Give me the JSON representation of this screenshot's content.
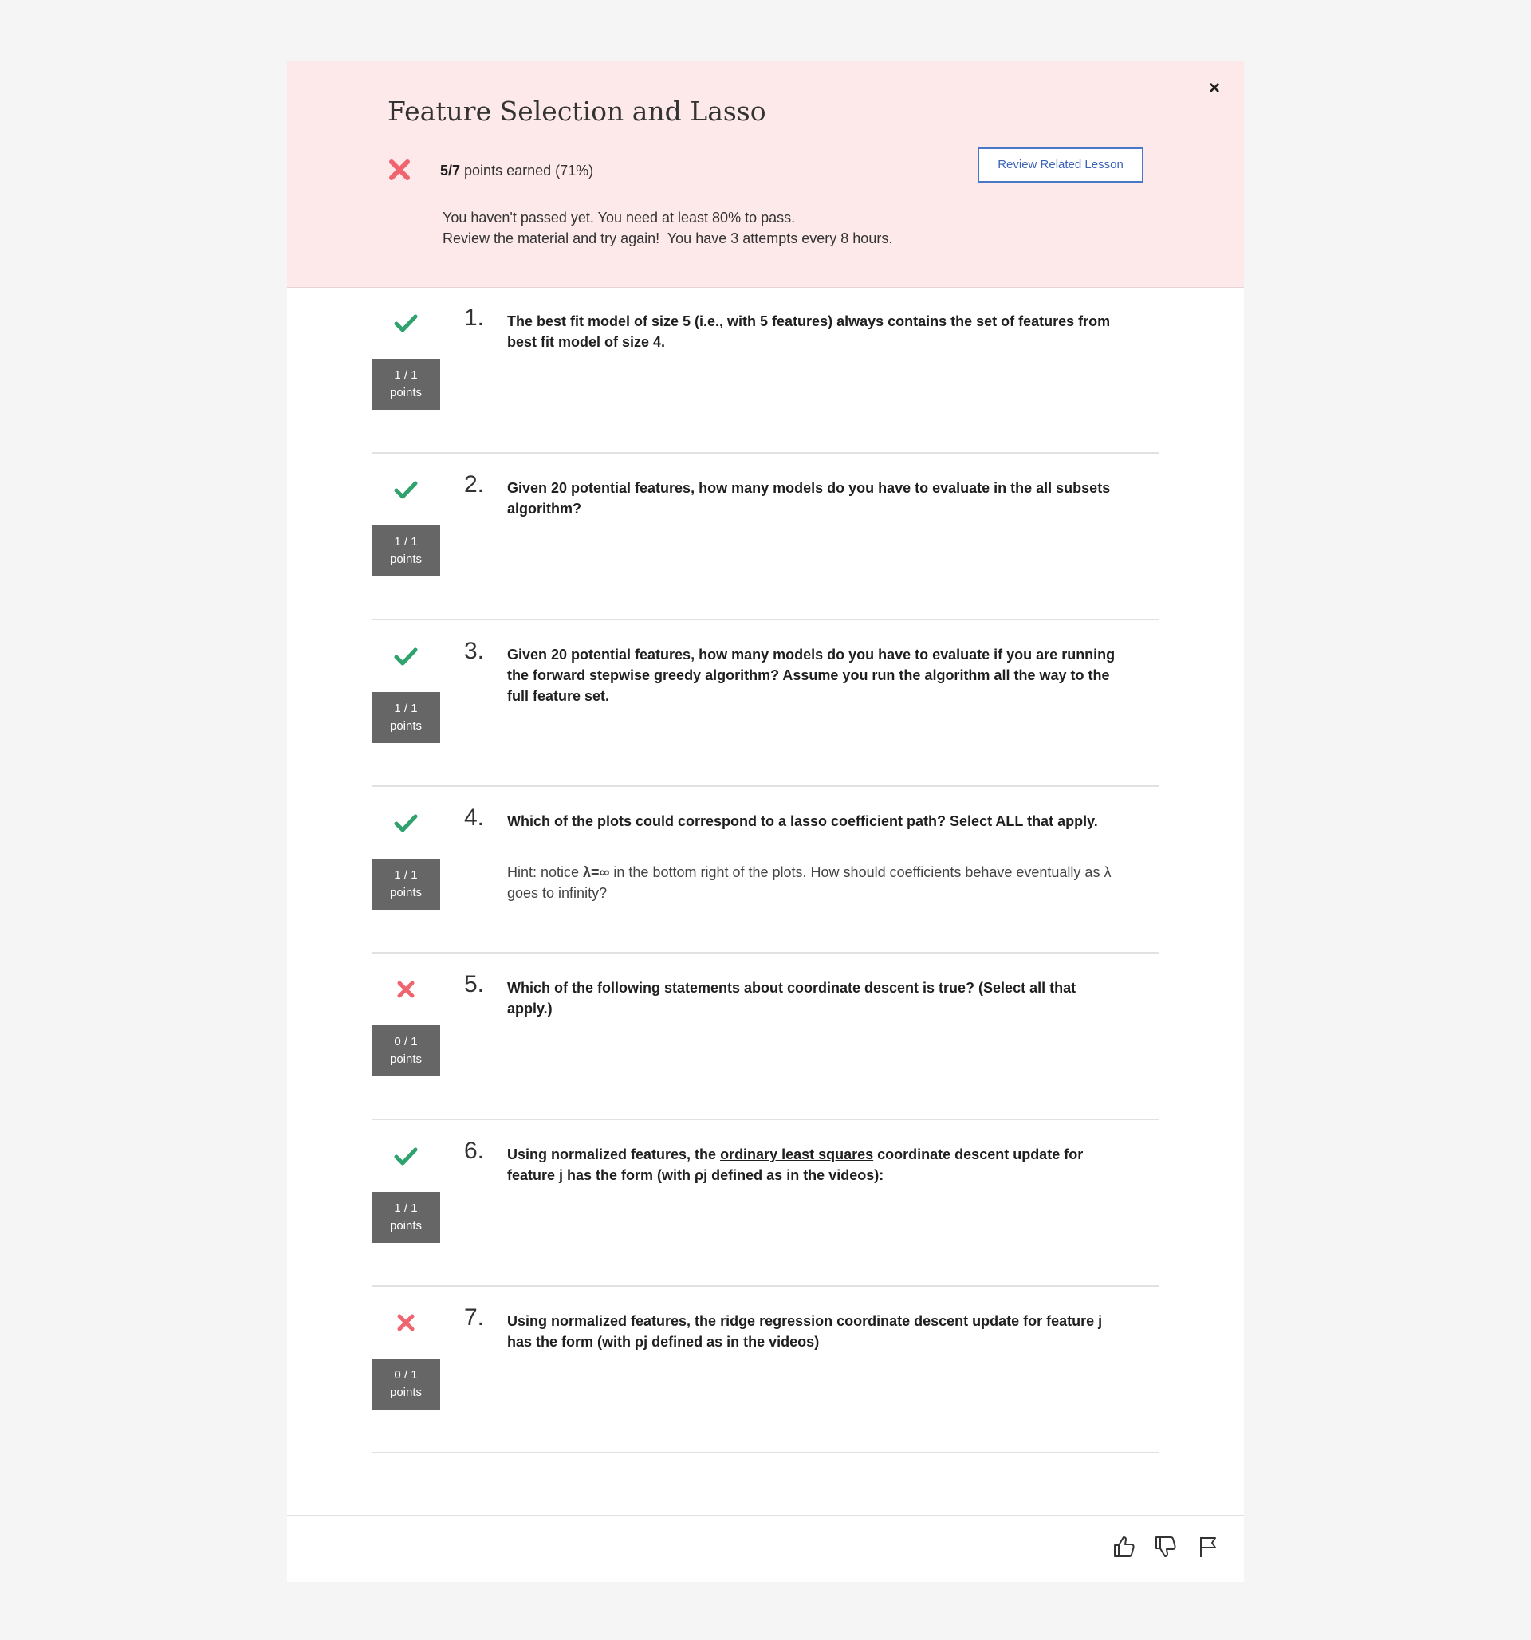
{
  "header": {
    "title": "Feature Selection and Lasso",
    "score_bold": "5/7",
    "score_rest": " points earned (71%)",
    "review_button": "Review Related Lesson",
    "message_line1": "You haven't passed yet. You need at least 80% to pass.",
    "message_line2": "Review the material and try again!  You have 3 attempts every 8 hours.",
    "close_label": "×"
  },
  "colors": {
    "correct": "#2fa26d",
    "incorrect": "#f0646e",
    "header_bg": "#fde8ea",
    "accent": "#4a78c9"
  },
  "questions": [
    {
      "number": "1.",
      "status": "correct",
      "points_line1": "1 / 1",
      "points_line2": "points",
      "text": "The best fit model of size 5 (i.e., with 5 features) always contains the set of features from best fit model of size 4."
    },
    {
      "number": "2.",
      "status": "correct",
      "points_line1": "1 / 1",
      "points_line2": "points",
      "text": "Given 20 potential features, how many models do you have to evaluate in the all subsets algorithm?"
    },
    {
      "number": "3.",
      "status": "correct",
      "points_line1": "1 / 1",
      "points_line2": "points",
      "text": "Given 20 potential features, how many models do you have to evaluate if you are running the forward stepwise greedy algorithm? Assume you run the algorithm all the way to the full feature set."
    },
    {
      "number": "4.",
      "status": "correct",
      "points_line1": "1 / 1",
      "points_line2": "points",
      "text": "Which of the plots could correspond to a lasso coefficient path? Select ALL that apply.",
      "hint_pre": "Hint: notice ",
      "hint_sym": "λ=∞",
      "hint_post": " in the bottom right of the plots. How should coefficients behave eventually as λ goes to infinity?"
    },
    {
      "number": "5.",
      "status": "incorrect",
      "points_line1": "0 / 1",
      "points_line2": "points",
      "text": "Which of the following statements about coordinate descent is true? (Select all that apply.)"
    },
    {
      "number": "6.",
      "status": "correct",
      "points_line1": "1 / 1",
      "points_line2": "points",
      "text_pre": "Using normalized features, the ",
      "text_link": "ordinary least squares",
      "text_post": " coordinate descent update for feature j has the form (with ρj defined as in the videos):"
    },
    {
      "number": "7.",
      "status": "incorrect",
      "points_line1": "0 / 1",
      "points_line2": "points",
      "text_pre": "Using normalized features, the ",
      "text_link": "ridge regression",
      "text_post": " coordinate descent update for feature j has the form (with ρj defined as in the videos)"
    }
  ],
  "footer": {
    "icons": [
      "thumbs-up-icon",
      "thumbs-down-icon",
      "flag-icon"
    ]
  }
}
